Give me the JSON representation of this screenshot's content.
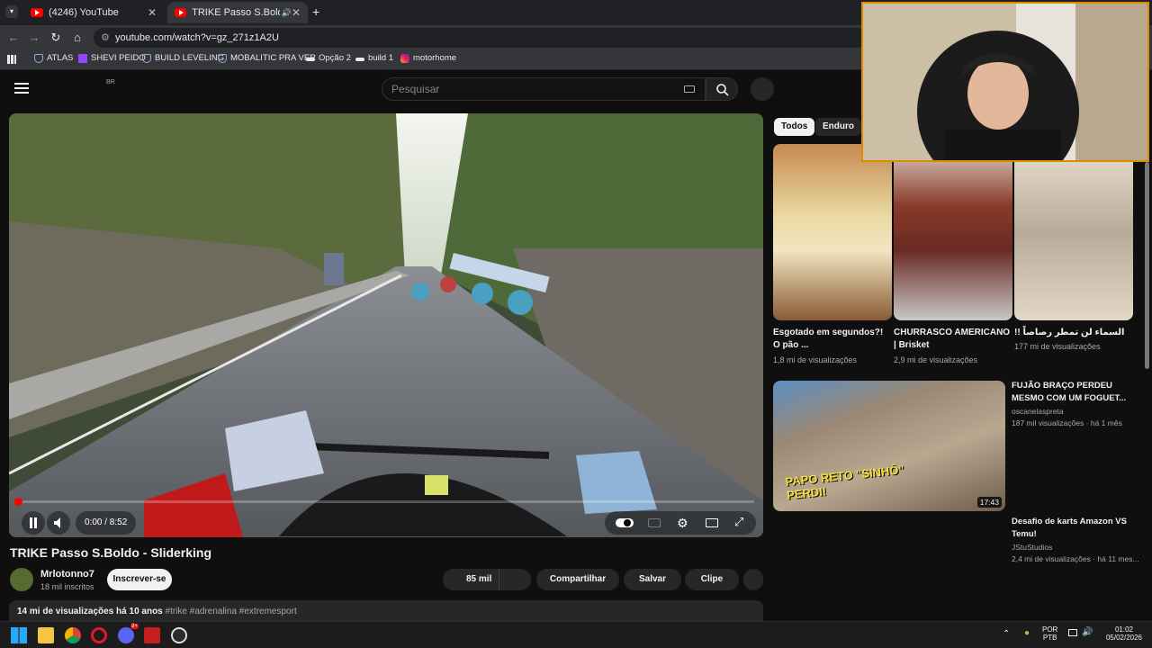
{
  "browser": {
    "tabs": [
      {
        "title": "(4246) YouTube",
        "active": false
      },
      {
        "title": "TRIKE Passo S.Boldo - Slide",
        "active": true
      }
    ],
    "new_tab": "+",
    "url": "youtube.com/watch?v=gz_271z1A2U",
    "bookmarks": [
      "ATLAS",
      "SHEVI PEIDO",
      "BUILD LEVELING",
      "MOBALITIC PRA VER",
      "Opção 2",
      "build 1",
      "motorhome"
    ]
  },
  "youtube": {
    "country": "BR",
    "search_placeholder": "Pesquisar"
  },
  "player": {
    "time": "0:00 / 8:52",
    "progress": 0.0
  },
  "video": {
    "title": "TRIKE Passo S.Boldo - Sliderking",
    "channel": "Mrlotonno7",
    "subscribers": "18 mil inscritos",
    "subscribe_label": "Inscrever-se",
    "likes": "85 mil",
    "share_label": "Compartilhar",
    "save_label": "Salvar",
    "clip_label": "Clipe",
    "views_date": "14 mi de visualizações  há 10 anos",
    "tags": "#trike #adrenalina #extremesport"
  },
  "sidebar": {
    "chips": [
      "Todos",
      "Enduro"
    ],
    "shorts": [
      {
        "title": "Esgotado em segundos?! O pão ...",
        "views": "1,8 mi de visualizações"
      },
      {
        "title": "CHURRASCO AMERICANO | Brisket",
        "views": "2,9 mi de visualizações"
      },
      {
        "title": "!! السماء لن تمطر رصاصاً",
        "views": "177 mi de visualizações"
      }
    ],
    "videos": [
      {
        "title": "FUJÃO BRAÇO PERDEU MESMO COM UM FOGUET...",
        "channel": "oscanelaspreta",
        "meta": "187 mil visualizações · há 1 mês",
        "duration": "17:43",
        "overlay_text": "PAPO RETO \"SINHÔ\" PERDI!"
      },
      {
        "title": "Desafio de karts Amazon VS Temu!",
        "channel": "JStuStudios",
        "meta": "2,4 mi de visualizações · há 11 mes..."
      }
    ]
  },
  "taskbar": {
    "language": "POR",
    "layout": "PTB",
    "time": "01:02",
    "date": "05/02/2026",
    "discord_badge": "9+"
  },
  "colors": {
    "accent_red": "#ff0000",
    "webcam_border": "#e08a00"
  }
}
